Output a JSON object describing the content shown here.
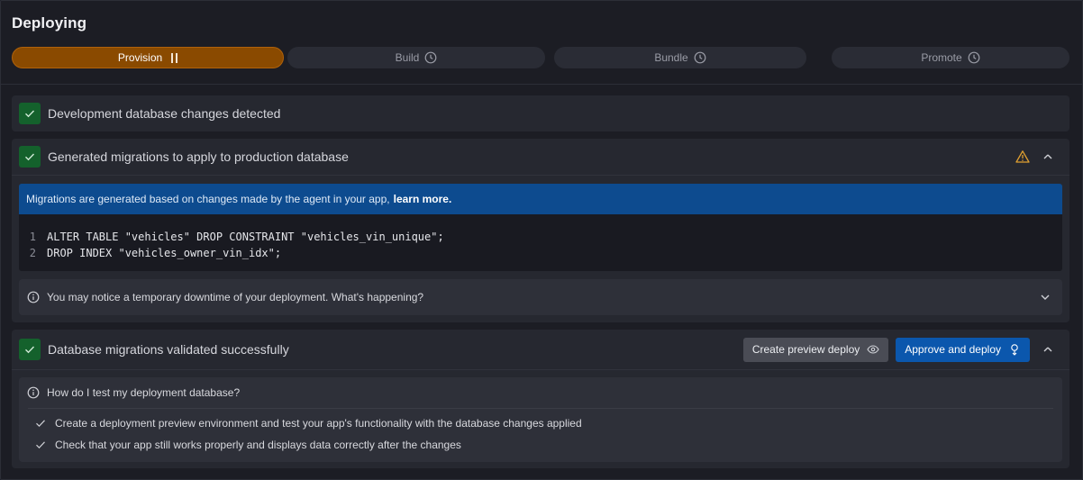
{
  "header": {
    "title": "Deploying"
  },
  "steps": [
    {
      "label": "Provision",
      "state": "active",
      "icon": "pause-icon"
    },
    {
      "label": "Build",
      "state": "pending",
      "icon": "clock-icon"
    },
    {
      "label": "Bundle",
      "state": "pending",
      "icon": "clock-icon"
    },
    {
      "label": "Promote",
      "state": "pending",
      "icon": "clock-icon"
    }
  ],
  "cards": {
    "changes_detected": {
      "title": "Development database changes detected"
    },
    "migrations": {
      "title": "Generated migrations to apply to production database",
      "banner_text": "Migrations are generated based on changes made by the agent in your app,",
      "banner_link": "learn more.",
      "code_lines": [
        {
          "num": "1",
          "text": "ALTER TABLE \"vehicles\" DROP CONSTRAINT \"vehicles_vin_unique\";"
        },
        {
          "num": "2",
          "text": "DROP INDEX \"vehicles_owner_vin_idx\";"
        }
      ],
      "notice": "You may notice a temporary downtime of your deployment. What's happening?"
    },
    "validated": {
      "title": "Database migrations validated successfully",
      "preview_button": "Create preview deploy",
      "approve_button": "Approve and deploy",
      "question": "How do I test my deployment database?",
      "items": [
        "Create a deployment preview environment and test your app's functionality with the database changes applied",
        "Check that your app still works properly and displays data correctly after the changes"
      ]
    }
  },
  "colors": {
    "active_step": "#8a4a00",
    "success": "#14612c",
    "info_banner": "#0d4b8f",
    "primary_button": "#0b57ad",
    "warning": "#e0a030"
  }
}
